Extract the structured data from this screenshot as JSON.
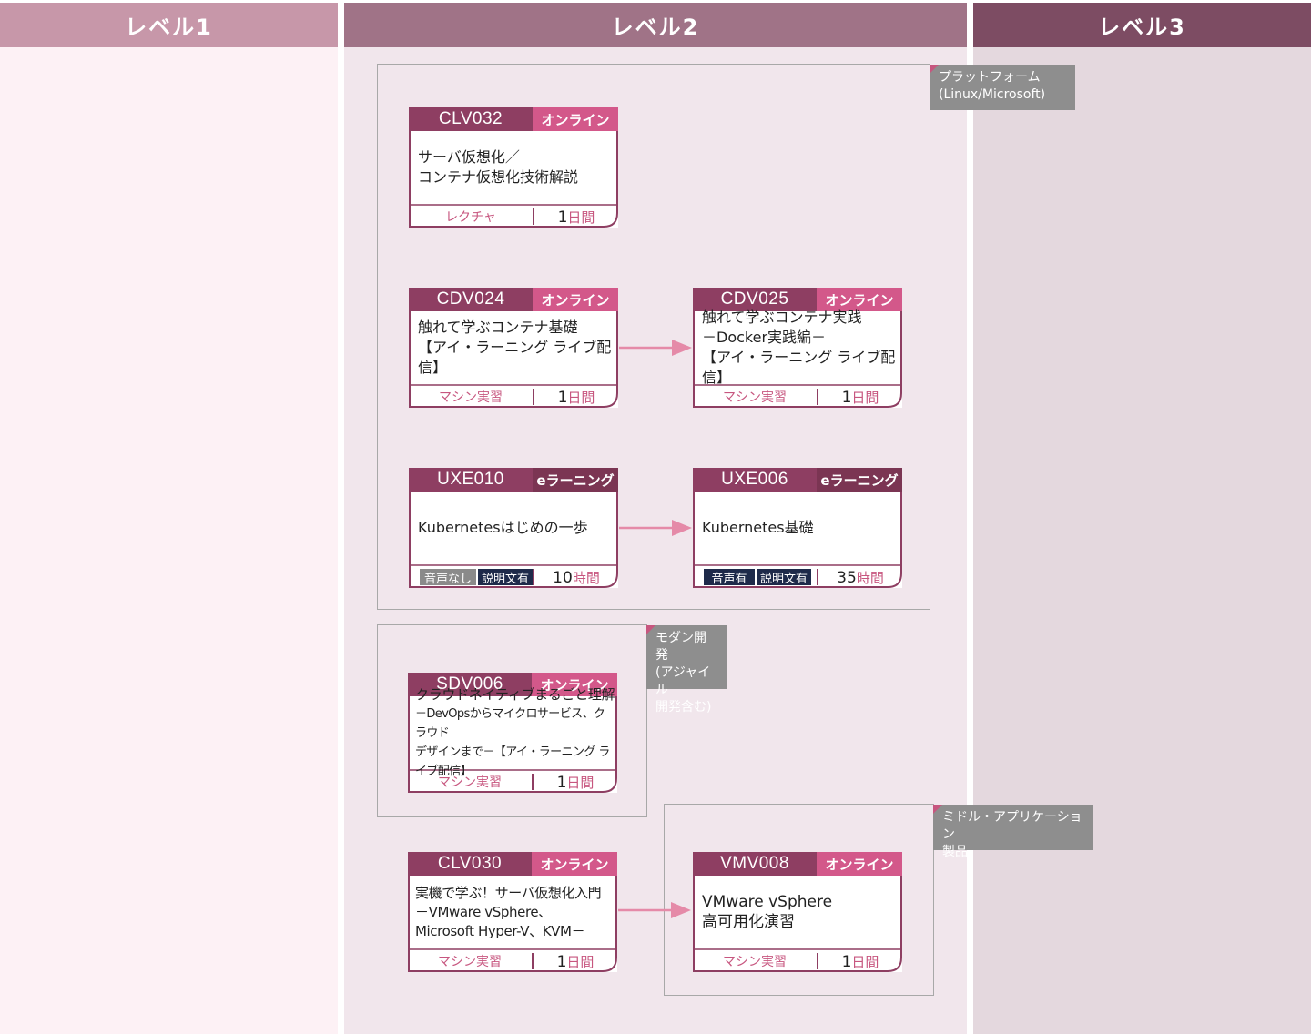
{
  "columns": [
    {
      "label": "レベル1",
      "head_color": "#c797a9",
      "body_color": "#fdf1f5"
    },
    {
      "label": "レベル2",
      "head_color": "#a07387",
      "body_color": "#f1e6ec"
    },
    {
      "label": "レベル3",
      "head_color": "#7d4c63",
      "body_color": "#e4d8de"
    }
  ],
  "groups": {
    "platform": "プラットフォーム\n(Linux/Microsoft)",
    "modern": "モダン開発\n(アジャイル\n開発含む)",
    "middleware": "ミドル・アプリケーション\n製品"
  },
  "cards": {
    "clv032": {
      "id": "CLV032",
      "type": "オンライン",
      "title": [
        "サーバ仮想化／",
        "コンテナ仮想化技術解説"
      ],
      "method": "レクチャ",
      "duration": "1",
      "unit": "日間"
    },
    "cdv024": {
      "id": "CDV024",
      "type": "オンライン",
      "title": [
        "触れて学ぶコンテナ基礎",
        "【アイ・ラーニング ライブ配信】"
      ],
      "method": "マシン実習",
      "duration": "1",
      "unit": "日間"
    },
    "cdv025": {
      "id": "CDV025",
      "type": "オンライン",
      "title": [
        "触れて学ぶコンテナ実践",
        "－Docker実践編－",
        "【アイ・ラーニング ライブ配信】"
      ],
      "method": "マシン実習",
      "duration": "1",
      "unit": "日間"
    },
    "uxe010": {
      "id": "UXE010",
      "type": "eラーニング",
      "title": [
        "Kubernetesはじめの一歩"
      ],
      "audio": "音声なし",
      "caption": "説明文有",
      "duration": "10",
      "unit": "時間"
    },
    "uxe006": {
      "id": "UXE006",
      "type": "eラーニング",
      "title": [
        "Kubernetes基礎"
      ],
      "audio": "音声有",
      "caption": "説明文有",
      "duration": "35",
      "unit": "時間"
    },
    "sdv006": {
      "id": "SDV006",
      "type": "オンライン",
      "title": [
        "クラウドネイティブまるごと理解",
        "－DevOpsからマイクロサービス、クラウド",
        "デザインまで－【アイ・ラーニング ライブ配信】"
      ],
      "method": "マシン実習",
      "duration": "1",
      "unit": "日間"
    },
    "clv030": {
      "id": "CLV030",
      "type": "オンライン",
      "title": [
        "実機で学ぶ！サーバ仮想化入門",
        "－VMware vSphere、",
        "Microsoft Hyper-V、KVM－"
      ],
      "method": "マシン実習",
      "duration": "1",
      "unit": "日間"
    },
    "vmv008": {
      "id": "VMV008",
      "type": "オンライン",
      "title": [
        "VMware vSphere",
        "高可用化演習"
      ],
      "method": "マシン実習",
      "duration": "1",
      "unit": "日間"
    }
  },
  "colors": {
    "accent": "#8e3e62",
    "pink": "#d3588a",
    "arrow": "#e58aa8",
    "audio_off": "#8a8a8a",
    "audio_on": "#1e2a4a"
  }
}
